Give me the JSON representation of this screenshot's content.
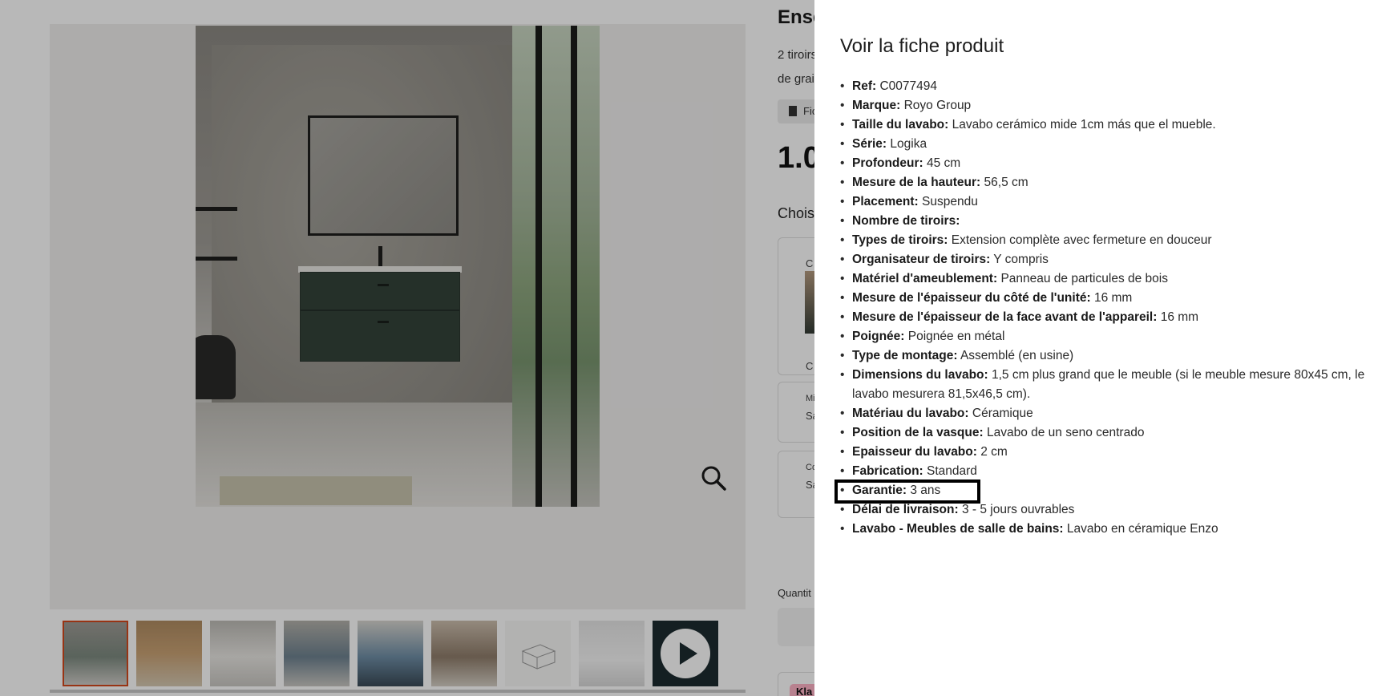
{
  "background_page": {
    "product_title": "Ense",
    "description_line1": "2 tiroirs",
    "description_line2": "de grai",
    "document_chip_label": "Fic",
    "price": "1.0",
    "choose_label": "Chois",
    "card_labels": [
      "C",
      "C",
      "Mi",
      "Sa",
      "Co",
      "Sa"
    ],
    "quantity_label": "Quantit",
    "klarna_badge": "Kla",
    "zoom_icon": "magnifier-icon",
    "video_icon": "play-icon"
  },
  "drawer": {
    "title": "Voir la fiche produit",
    "specs": [
      {
        "key": "Ref:",
        "value": "C0077494"
      },
      {
        "key": "Marque:",
        "value": "Royo Group"
      },
      {
        "key": "Taille du lavabo:",
        "value": "Lavabo cerámico mide 1cm más que el mueble."
      },
      {
        "key": "Série:",
        "value": "Logika"
      },
      {
        "key": "Profondeur:",
        "value": "45 cm"
      },
      {
        "key": "Mesure de la hauteur:",
        "value": "56,5 cm"
      },
      {
        "key": "Placement:",
        "value": "Suspendu"
      },
      {
        "key": "Nombre de tiroirs:",
        "value": ""
      },
      {
        "key": "Types de tiroirs:",
        "value": "Extension complète avec fermeture en douceur"
      },
      {
        "key": "Organisateur de tiroirs:",
        "value": "Y compris"
      },
      {
        "key": "Matériel d'ameublement:",
        "value": "Panneau de particules de bois"
      },
      {
        "key": "Mesure de l'épaisseur du côté de l'unité:",
        "value": "16 mm"
      },
      {
        "key": "Mesure de l'épaisseur de la face avant de l'appareil:",
        "value": "16 mm"
      },
      {
        "key": "Poignée:",
        "value": "Poignée en métal"
      },
      {
        "key": "Type de montage:",
        "value": "Assemblé (en usine)"
      },
      {
        "key": "Dimensions du lavabo:",
        "value": "1,5 cm plus grand que le meuble (si le meuble mesure 80x45 cm, le lavabo mesurera 81,5x46,5 cm)."
      },
      {
        "key": "Matériau du lavabo:",
        "value": "Céramique"
      },
      {
        "key": "Position de la vasque:",
        "value": "Lavabo de un seno centrado"
      },
      {
        "key": "Epaisseur du lavabo:",
        "value": "2 cm"
      },
      {
        "key": "Fabrication:",
        "value": "Standard"
      },
      {
        "key": "Garantie:",
        "value": "3 ans"
      },
      {
        "key": "Délai de livraison:",
        "value": "3 - 5 jours ouvrables"
      },
      {
        "key": "Lavabo - Meubles de salle de bains:",
        "value": "Lavabo en céramique Enzo"
      }
    ]
  },
  "colors": {
    "overlay": "rgba(0,0,0,0.28)",
    "active_thumb_border": "#d3491c",
    "highlight_box": "#000000"
  }
}
